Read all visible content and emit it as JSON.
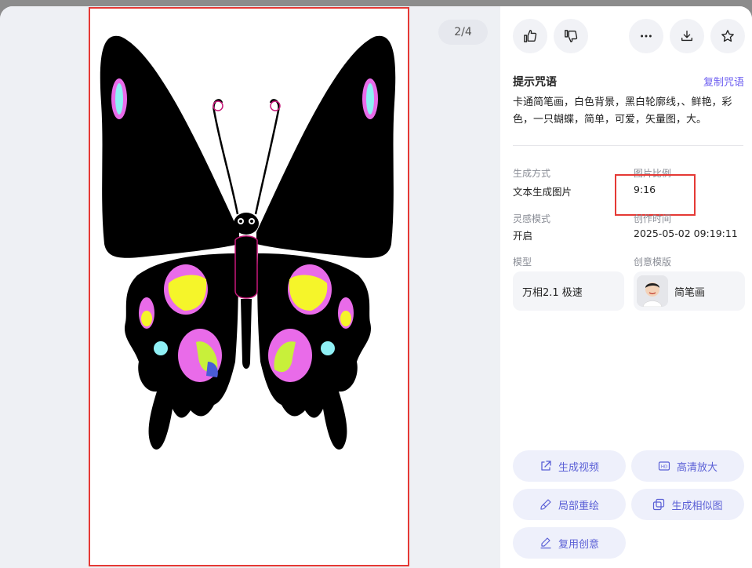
{
  "viewer": {
    "page_counter": "2/4"
  },
  "toolbar": {
    "like_icon": "thumbs-up-icon",
    "dislike_icon": "thumbs-down-icon",
    "more_icon": "more-icon",
    "download_icon": "download-icon",
    "favorite_icon": "star-icon"
  },
  "prompt": {
    "title": "提示咒语",
    "copy_label": "复制咒语",
    "text": "卡通简笔画，白色背景，黑白轮廓线，、鲜艳，彩色，一只蝴蝶，简单，可爱，矢量图，大。"
  },
  "meta": {
    "gen_mode_label": "生成方式",
    "gen_mode_value": "文本生成图片",
    "ratio_label": "图片比例",
    "ratio_value": "9:16",
    "inspiration_label": "灵感模式",
    "inspiration_value": "开启",
    "created_label": "创作时间",
    "created_value": "2025-05-02 09:19:11",
    "model_label": "模型",
    "model_value": "万相2.1 极速",
    "template_label": "创意模版",
    "template_value": "简笔画"
  },
  "actions": {
    "generate_video": "生成视频",
    "hd_upscale": "高清放大",
    "local_repaint": "局部重绘",
    "generate_similar": "生成相似图",
    "reuse_idea": "复用创意"
  },
  "colors": {
    "accent": "#5a5fd6",
    "highlight": "#e53935",
    "wing_pink": "#e96be9",
    "wing_yellow": "#f5f52a",
    "wing_cyan": "#8ff0f5"
  }
}
